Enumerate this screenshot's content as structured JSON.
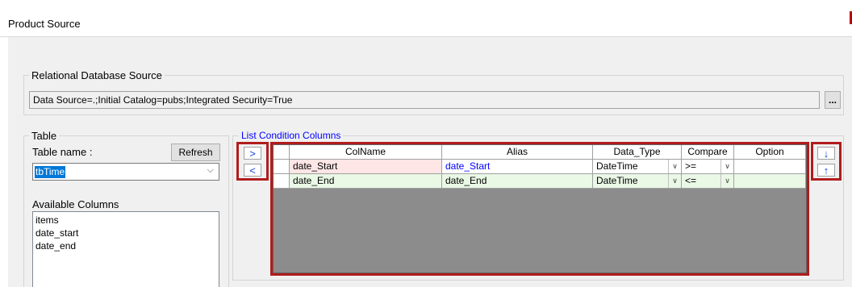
{
  "window": {
    "title": "Product Source"
  },
  "rds": {
    "legend": "Relational Database Source",
    "connection_string": "Data Source=.;Initial Catalog=pubs;Integrated Security=True",
    "browse_label": "..."
  },
  "table": {
    "legend": "Table",
    "name_label": "Table name :",
    "refresh_label": "Refresh",
    "selected_table": "tbTime",
    "available_label": "Available Columns",
    "available_columns": [
      "items",
      "date_start",
      "date_end"
    ]
  },
  "conditions": {
    "legend": "List Condition Columns",
    "add_label": ">",
    "remove_label": "<",
    "move_down_label": "↓",
    "move_up_label": "↑",
    "headers": [
      "ColName",
      "Alias",
      "Data_Type",
      "Compare",
      "Option"
    ],
    "rows": [
      {
        "colname": "date_Start",
        "alias": "date_Start",
        "data_type": "DateTime",
        "compare": ">=",
        "option": ""
      },
      {
        "colname": "date_End",
        "alias": "date_End",
        "data_type": "DateTime",
        "compare": "<=",
        "option": ""
      }
    ],
    "row_colors": [
      "#ffe6e6",
      "#eaf8e6"
    ],
    "alias_link_color": "#0000ff"
  },
  "colors": {
    "highlight_box": "#b11c1c",
    "legend_accent": "#0000ff"
  }
}
